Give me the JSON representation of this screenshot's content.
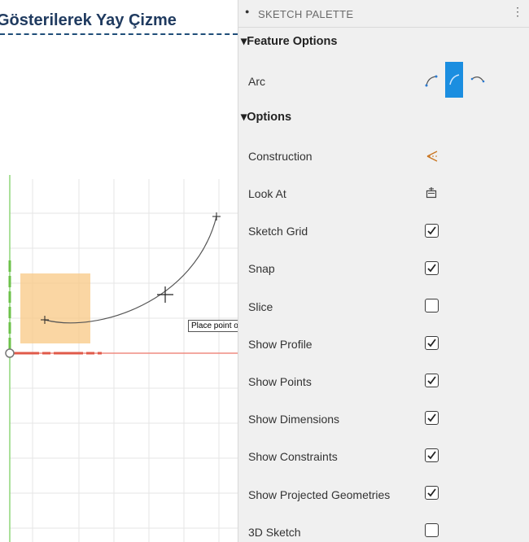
{
  "document_title": "Gösterilerek Yay Çizme",
  "tooltip": "Place point on arc",
  "palette": {
    "title": "SKETCH PALETTE",
    "feature_options_label": "Feature Options",
    "arc_label": "Arc",
    "options_label": "Options",
    "rows": [
      {
        "label": "Construction",
        "control": "construction-icon"
      },
      {
        "label": "Look At",
        "control": "look-at-icon"
      },
      {
        "label": "Sketch Grid",
        "checked": true
      },
      {
        "label": "Snap",
        "checked": true
      },
      {
        "label": "Slice",
        "checked": false
      },
      {
        "label": "Show Profile",
        "checked": true
      },
      {
        "label": "Show Points",
        "checked": true
      },
      {
        "label": "Show Dimensions",
        "checked": true
      },
      {
        "label": "Show Constraints",
        "checked": true
      },
      {
        "label": "Show Projected Geometries",
        "checked": true
      },
      {
        "label": "3D Sketch",
        "checked": false
      }
    ]
  },
  "colors": {
    "accent": "#1b8ee0",
    "x_axis": "#e05a4a",
    "y_axis": "#6cc24a",
    "profile_fill": "#f8c884"
  }
}
